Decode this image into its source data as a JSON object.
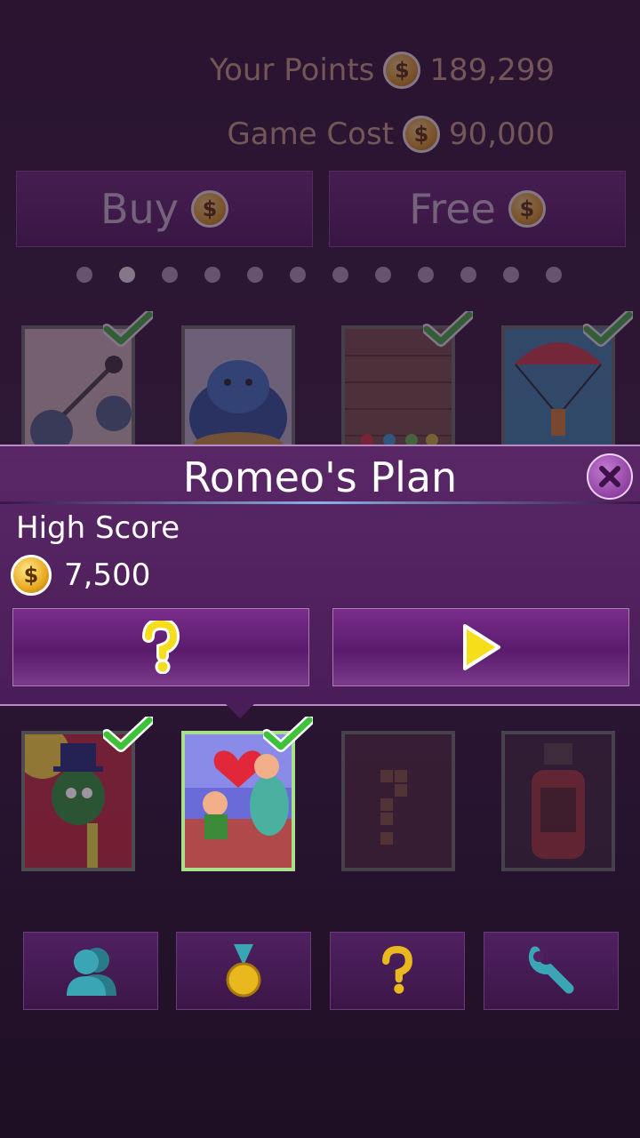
{
  "stats": {
    "points_label": "Your Points",
    "points_value": "189,299",
    "cost_label": "Game Cost",
    "cost_value": "90,000",
    "coin_symbol": "$"
  },
  "purchase": {
    "buy_label": "Buy",
    "free_label": "Free"
  },
  "pager": {
    "count": 12,
    "active_index": 1
  },
  "games_row_top": [
    {
      "icon": "yarn-molecule-thumbnail",
      "completed": true
    },
    {
      "icon": "blue-creature-thumbnail",
      "completed": false
    },
    {
      "icon": "brick-wall-gems-thumbnail",
      "completed": true
    },
    {
      "icon": "parachute-thumbnail",
      "completed": true
    }
  ],
  "games_row_bottom": [
    {
      "icon": "green-character-top-hat-thumbnail",
      "completed": true,
      "locked": false
    },
    {
      "icon": "romeos-plan-thumbnail",
      "completed": true,
      "locked": false,
      "selected": true
    },
    {
      "icon": "falling-blocks-thumbnail",
      "completed": false,
      "locked": true
    },
    {
      "icon": "race-car-thumbnail",
      "completed": false,
      "locked": true
    }
  ],
  "popup": {
    "title": "Romeo's Plan",
    "high_score_label": "High Score",
    "high_score_value": "7,500",
    "help_icon": "question-icon",
    "play_icon": "play-icon"
  },
  "nav": [
    {
      "icon": "profile-icon"
    },
    {
      "icon": "medal-icon"
    },
    {
      "icon": "question-icon"
    },
    {
      "icon": "wrench-icon"
    }
  ],
  "colors": {
    "accent_purple": "#5a2766",
    "coin_gold": "#e9a81f",
    "check_green": "#3ec23a",
    "icon_yellow": "#f6de1b",
    "icon_teal": "#3aa6b5"
  }
}
